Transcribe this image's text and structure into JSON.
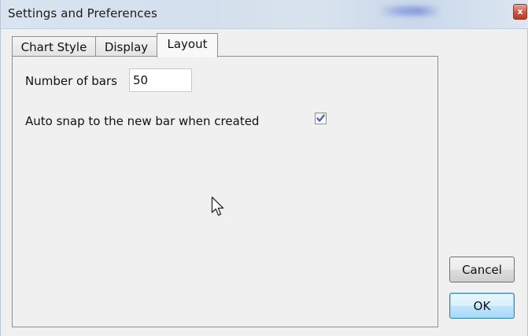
{
  "window": {
    "title": "Settings and Preferences",
    "close_glyph": "x"
  },
  "tabs": [
    {
      "label": "Chart Style",
      "active": false
    },
    {
      "label": "Display",
      "active": false
    },
    {
      "label": "Layout",
      "active": true
    }
  ],
  "layout_tab": {
    "bars_label": "Number of bars",
    "bars_value": "50",
    "auto_snap_label": "Auto snap to the new bar when created",
    "auto_snap_checked": true
  },
  "buttons": {
    "cancel_label": "Cancel",
    "ok_label": "OK"
  },
  "colors": {
    "titlebar": "#d3dfec",
    "close_button": "#cc5c47",
    "default_button": "#bee6fd",
    "checkmark": "#4a5fa8"
  },
  "icons": {
    "close": "close-icon",
    "check": "checkmark-icon",
    "pointer": "mouse-pointer-icon"
  }
}
